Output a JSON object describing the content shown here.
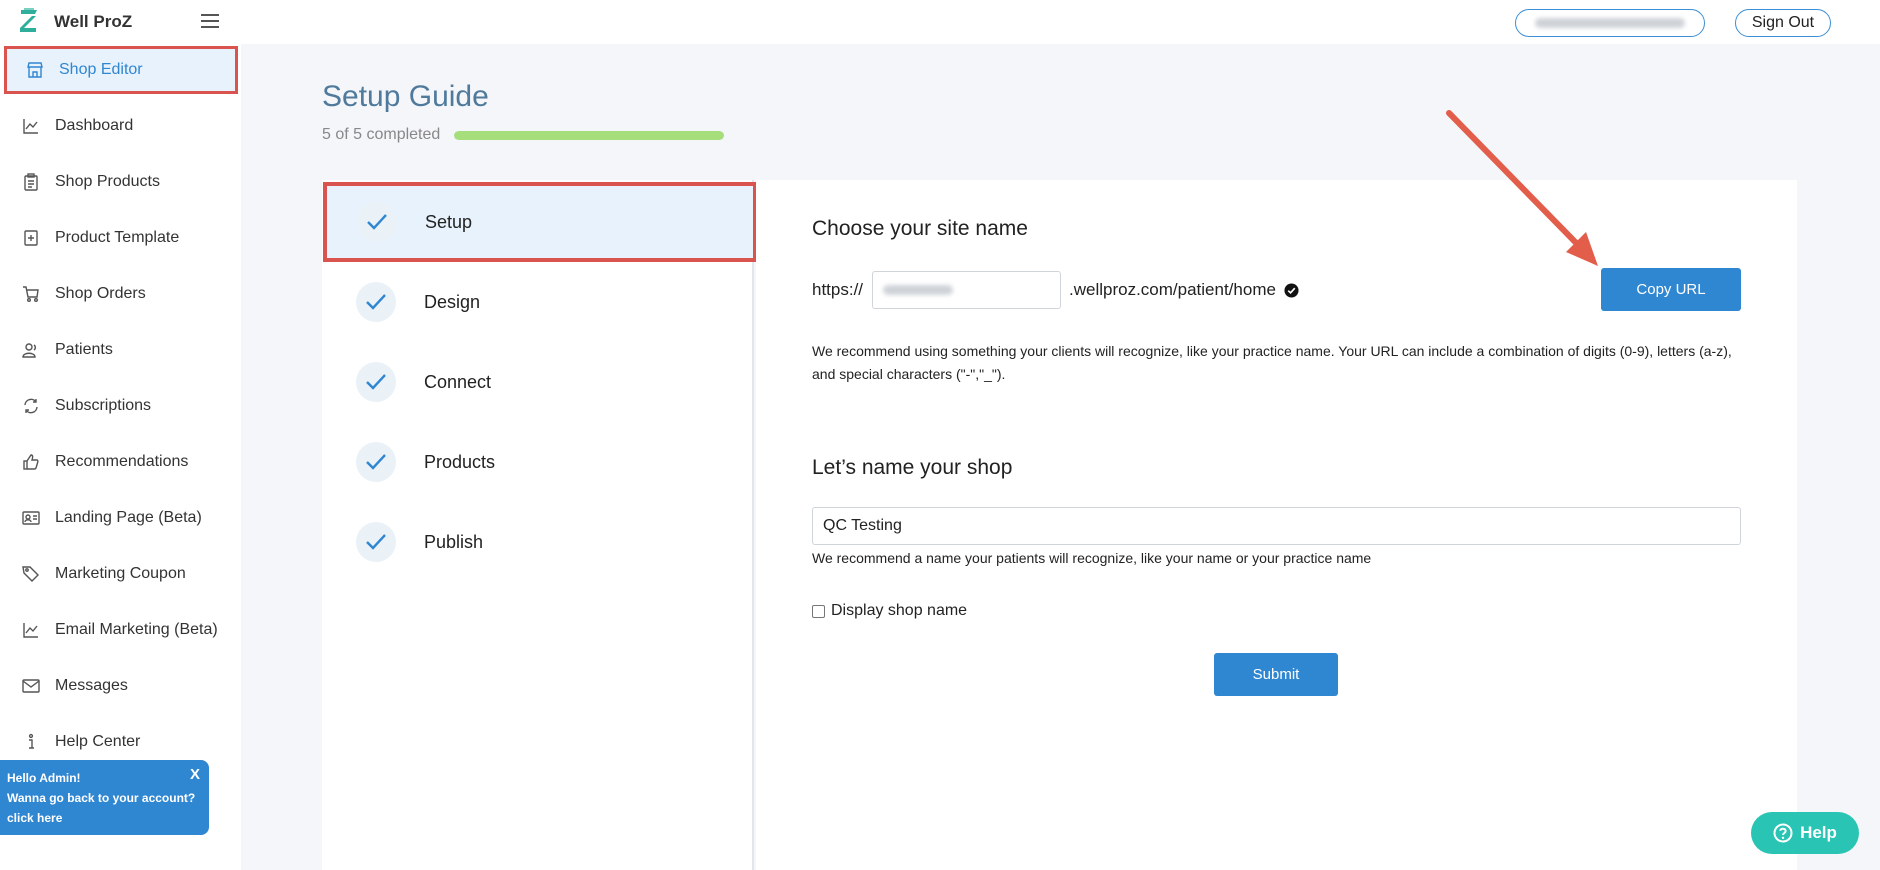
{
  "app": {
    "name": "Well ProZ"
  },
  "header": {
    "signout_label": "Sign Out"
  },
  "sidebar": {
    "items": [
      {
        "label": "Shop Editor",
        "icon": "store-icon"
      },
      {
        "label": "Dashboard",
        "icon": "chart-line-icon"
      },
      {
        "label": "Shop Products",
        "icon": "clipboard-icon"
      },
      {
        "label": "Product Template",
        "icon": "template-plus-icon"
      },
      {
        "label": "Shop Orders",
        "icon": "cart-icon"
      },
      {
        "label": "Patients",
        "icon": "users-icon"
      },
      {
        "label": "Subscriptions",
        "icon": "refresh-icon"
      },
      {
        "label": "Recommendations",
        "icon": "thumbs-up-icon"
      },
      {
        "label": "Landing Page (Beta)",
        "icon": "id-card-icon"
      },
      {
        "label": "Marketing Coupon",
        "icon": "tags-icon"
      },
      {
        "label": "Email Marketing (Beta)",
        "icon": "chart-line-icon"
      },
      {
        "label": "Messages",
        "icon": "envelope-icon"
      },
      {
        "label": "Help Center",
        "icon": "info-icon"
      }
    ],
    "hello": {
      "line1": "Hello Admin!",
      "line2": "Wanna go back to your account?",
      "line3": "click here",
      "close": "X"
    }
  },
  "guide": {
    "title": "Setup Guide",
    "progress_text": "5 of 5 completed",
    "progress_fraction": 1.0,
    "steps": [
      {
        "label": "Setup"
      },
      {
        "label": "Design"
      },
      {
        "label": "Connect"
      },
      {
        "label": "Products"
      },
      {
        "label": "Publish"
      }
    ]
  },
  "site": {
    "title": "Choose your site name",
    "prefix": "https://",
    "suffix": ".wellproz.com/patient/home",
    "copy_label": "Copy URL",
    "help": "We recommend using something your clients will recognize, like your practice name. Your URL can include a combination of digits (0-9), letters (a-z), and special characters (\"-\",\"_\")."
  },
  "shop": {
    "title": "Let’s name your shop",
    "value": "QC Testing",
    "help": "We recommend a name your patients will recognize, like your name or your practice name",
    "display_label": "Display shop name",
    "submit_label": "Submit"
  },
  "help_fab": {
    "label": "Help"
  },
  "colors": {
    "accent": "#2f86d1",
    "highlight": "#d9534f",
    "progress": "#a5de7a",
    "help": "#29c4b3"
  }
}
